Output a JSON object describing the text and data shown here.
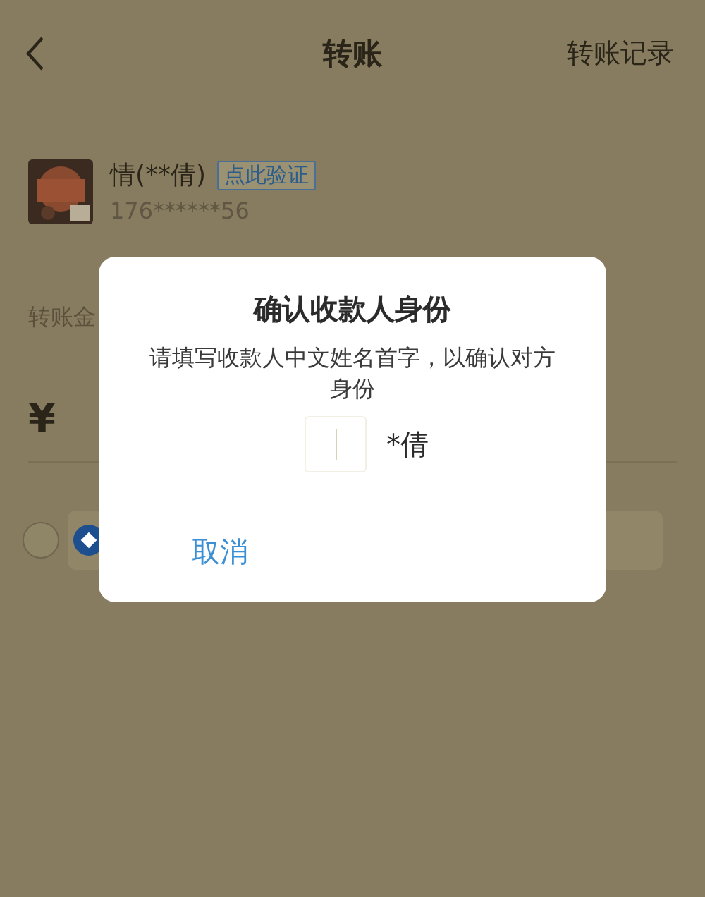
{
  "nav": {
    "title": "转账",
    "action": "转账记录"
  },
  "payee": {
    "name": "情(**倩)",
    "verify_badge": "点此验证",
    "phone": "176******56"
  },
  "amount_label": "转账金",
  "currency": "¥",
  "payment_method": {
    "selected": false
  },
  "dialog": {
    "title": "确认收款人身份",
    "message": "请填写收款人中文姓名首字，以确认对方身份",
    "masked_name": "*倩",
    "cancel": "取消"
  }
}
